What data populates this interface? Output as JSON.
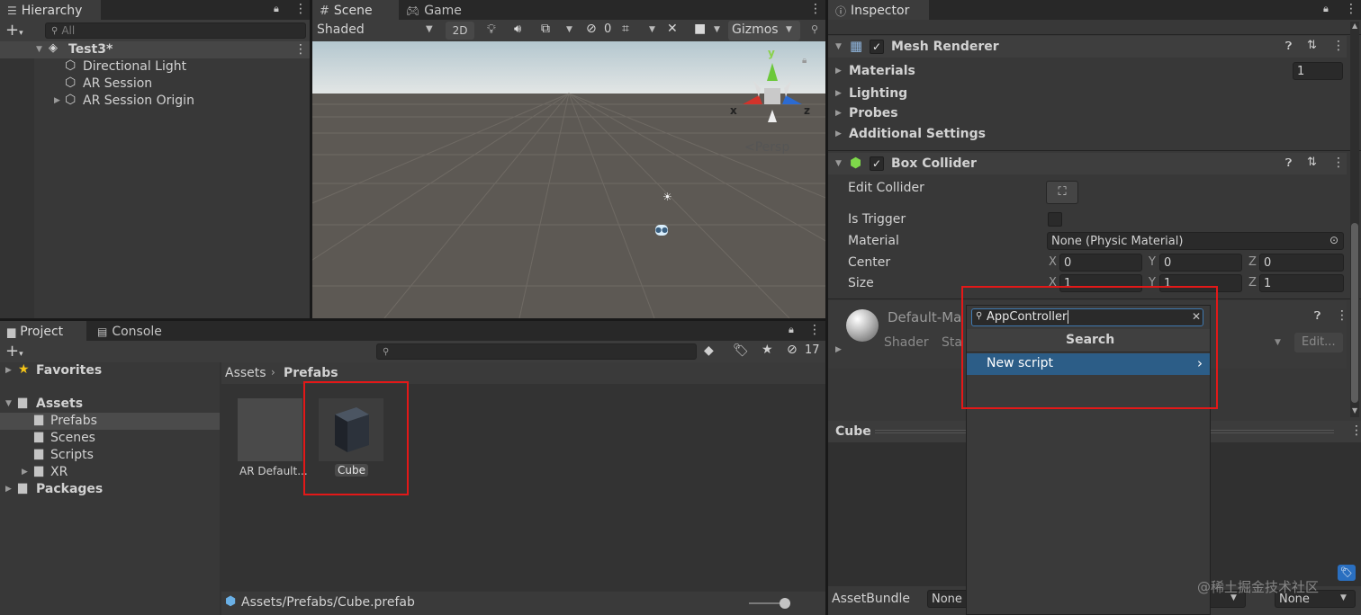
{
  "hierarchy": {
    "tab_label": "Hierarchy",
    "search_placeholder": "All",
    "scene_name": "Test3*",
    "items": [
      "Directional Light",
      "AR Session",
      "AR Session Origin"
    ]
  },
  "scene": {
    "tabs": [
      "Scene",
      "Game"
    ],
    "shading_mode": "Shaded",
    "toggle_2d": "2D",
    "hidden_count": "0",
    "gizmos_label": "Gizmos",
    "persp_label": "Persp",
    "axis_x": "x",
    "axis_y": "y",
    "axis_z": "z"
  },
  "project": {
    "tabs": [
      "Project",
      "Console"
    ],
    "favorites_label": "Favorites",
    "assets_label": "Assets",
    "folders": [
      "Prefabs",
      "Scenes",
      "Scripts",
      "XR"
    ],
    "packages_label": "Packages",
    "breadcrumb_root": "Assets",
    "breadcrumb_current": "Prefabs",
    "hidden_count": "17",
    "assets": [
      "AR Default...",
      "Cube"
    ],
    "footer_path": "Assets/Prefabs/Cube.prefab"
  },
  "inspector": {
    "tab_label": "Inspector",
    "mesh_renderer": {
      "title": "Mesh Renderer",
      "enabled": true,
      "materials_label": "Materials",
      "materials_count": "1",
      "lighting_label": "Lighting",
      "probes_label": "Probes",
      "additional_label": "Additional Settings"
    },
    "box_collider": {
      "title": "Box Collider",
      "enabled": true,
      "edit_collider_label": "Edit Collider",
      "is_trigger_label": "Is Trigger",
      "material_label": "Material",
      "material_value": "None (Physic Material)",
      "center_label": "Center",
      "size_label": "Size",
      "center": {
        "x": "0",
        "y": "0",
        "z": "0"
      },
      "size": {
        "x": "1",
        "y": "1",
        "z": "1"
      },
      "x_label": "X",
      "y_label": "Y",
      "z_label": "Z"
    },
    "material_block": {
      "name": "Default-Ma",
      "shader_label": "Shader",
      "shader_value": "Sta",
      "edit_label": "Edit..."
    },
    "preview_title": "Cube",
    "assetbundle_label": "AssetBundle",
    "assetbundle_value": "None",
    "assetbundle_variant": "None"
  },
  "add_component_popup": {
    "search_value": "AppController",
    "header": "Search",
    "new_script_label": "New script"
  },
  "watermark": "@稀土掘金技术社区",
  "colors": {
    "panel_bg": "#383838",
    "tab_bg": "#282828",
    "highlight_blue": "#2c5d87",
    "selection_red": "#e31818"
  }
}
